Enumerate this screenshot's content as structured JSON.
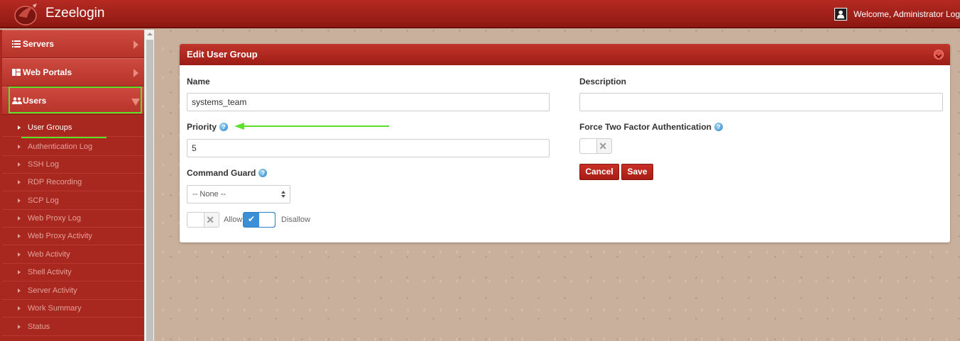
{
  "app": {
    "brand": "Ezeelogin",
    "welcome": "Welcome, Administrator Log"
  },
  "sidebar": {
    "main_items": [
      {
        "label": "Servers",
        "icon": "list-icon"
      },
      {
        "label": "Web Portals",
        "icon": "dashboard-icon"
      },
      {
        "label": "Users",
        "icon": "users-icon"
      }
    ],
    "sub_items": [
      "User Groups",
      "Authentication Log",
      "SSH Log",
      "RDP Recording",
      "SCP Log",
      "Web Proxy Log",
      "Web Proxy Activity",
      "Web Activity",
      "Shell Activity",
      "Server Activity",
      "Work Summary",
      "Status"
    ],
    "active_sub_item": "User Groups"
  },
  "panel": {
    "title": "Edit User Group",
    "name_label": "Name",
    "name_value": "systems_team",
    "description_label": "Description",
    "description_value": "",
    "priority_label": "Priority",
    "priority_value": "5",
    "force_2fa_label": "Force Two Factor Authentication",
    "force_2fa_enabled": false,
    "command_guard_label": "Command Guard",
    "command_guard_selected": "-- None --",
    "allow_label": "Allow",
    "disallow_label": "Disallow",
    "allow_enabled": false,
    "disallow_enabled": true,
    "cancel_label": "Cancel",
    "save_label": "Save"
  },
  "colors": {
    "accent_red": "#b52a22",
    "highlight_green": "#5ce02a",
    "toggle_blue": "#3a8fd6"
  }
}
